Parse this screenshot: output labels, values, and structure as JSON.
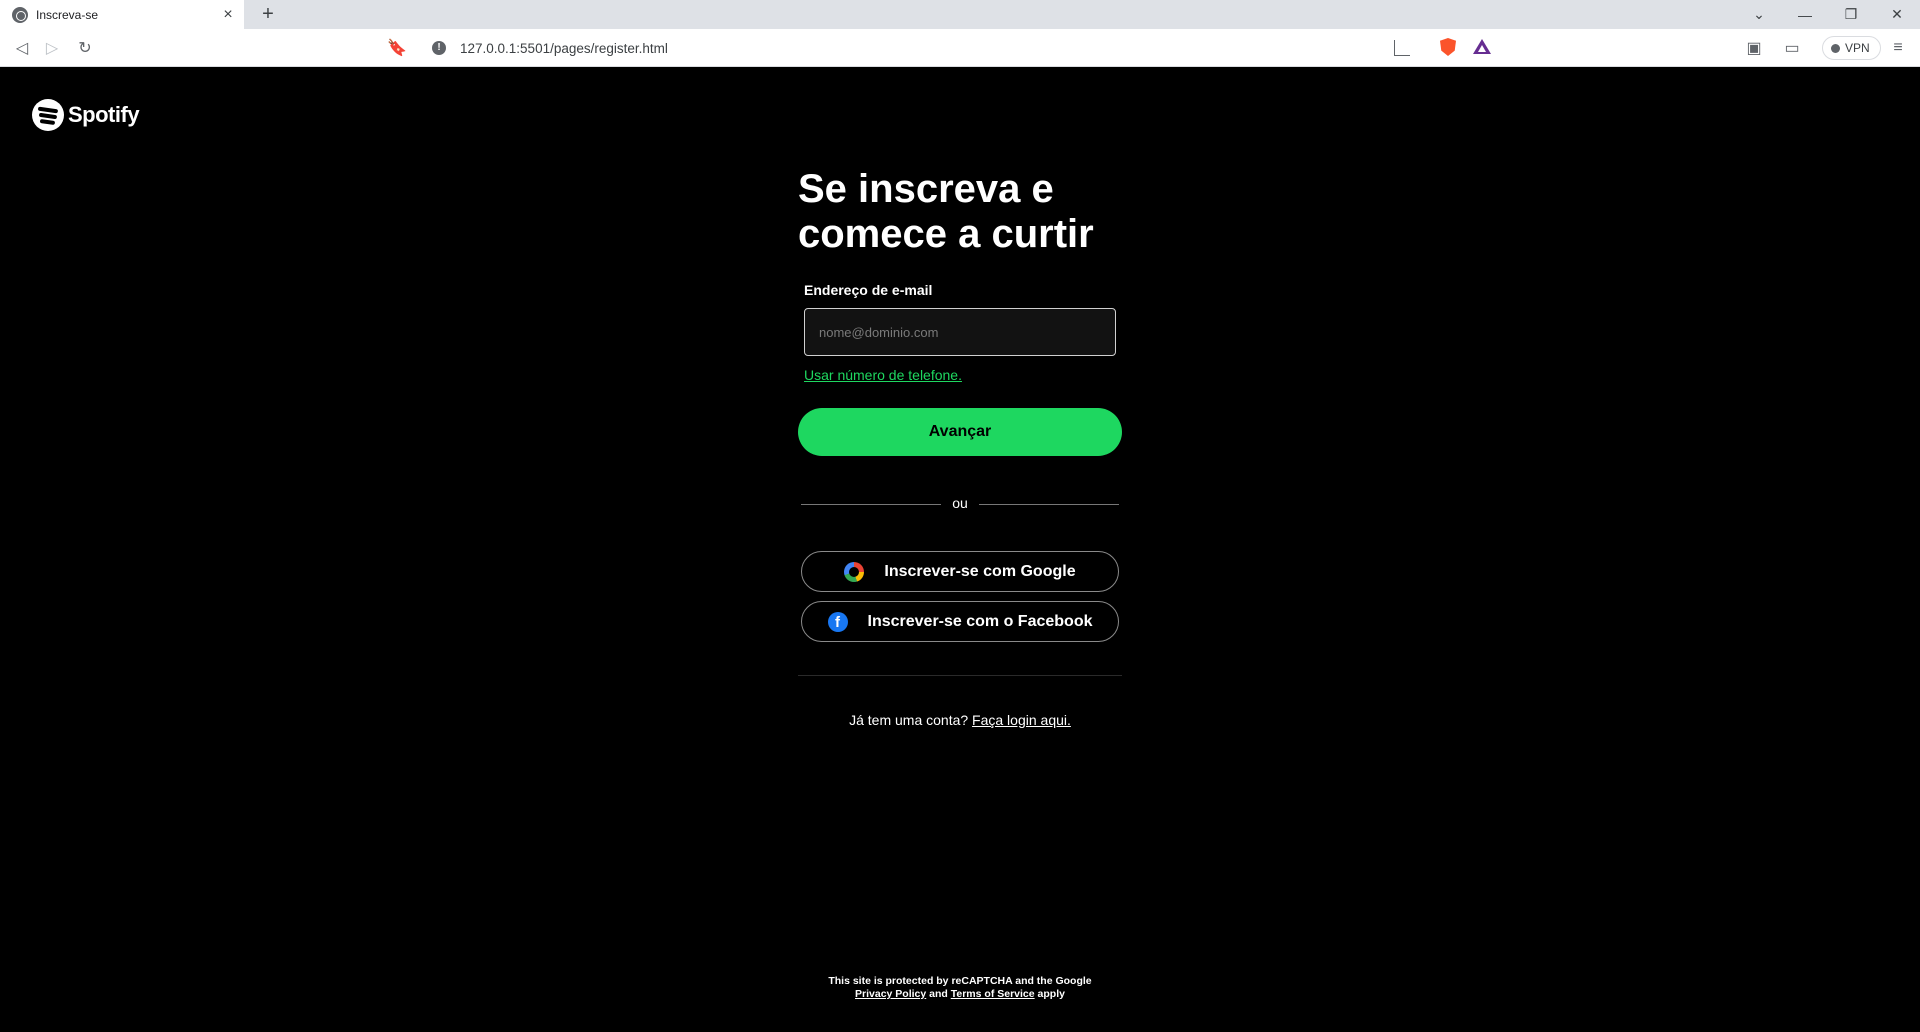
{
  "browser": {
    "tab_title": "Inscreva-se",
    "url": "127.0.0.1:5501/pages/register.html",
    "vpn_label": "VPN"
  },
  "page": {
    "logo_text": "Spotify",
    "headline": "Se inscreva e comece a curtir",
    "email_label": "Endereço de e-mail",
    "email_placeholder": "nome@dominio.com",
    "email_value": "",
    "phone_link": "Usar número de telefone.",
    "next_button": "Avançar",
    "or_text": "ou",
    "google_button": "Inscrever-se com Google",
    "facebook_button": "Inscrever-se com o Facebook",
    "have_account_text": "Já tem uma conta?",
    "login_link": "Faça login aqui.",
    "footer": {
      "line1": "This site is protected by reCAPTCHA and the Google",
      "privacy_link": "Privacy Policy",
      "and_text": "and",
      "terms_link": "Terms of Service",
      "apply_text": "apply"
    }
  },
  "colors": {
    "accent": "#1ed760",
    "background": "#000000"
  }
}
